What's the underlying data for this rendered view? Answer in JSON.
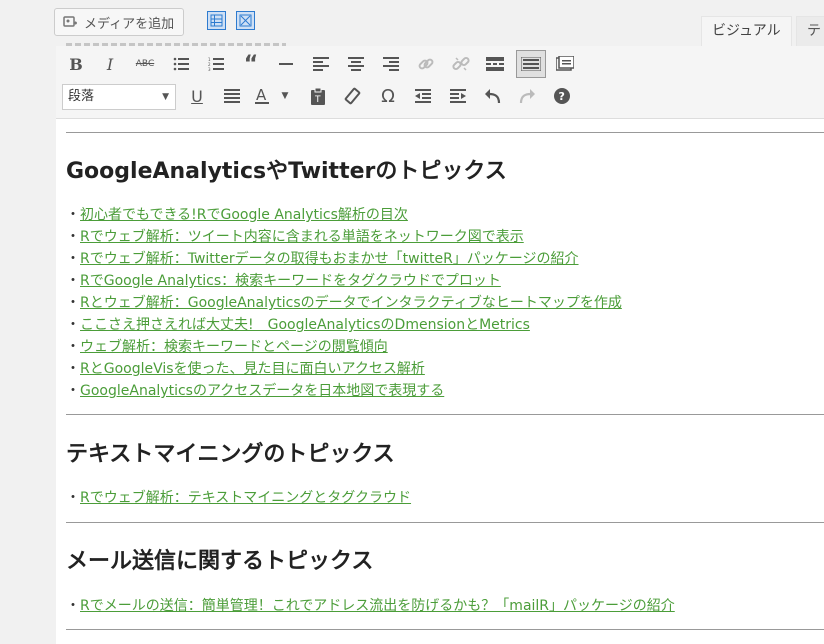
{
  "topbar": {
    "media_button_label": "メディアを追加",
    "tabs": [
      "ビジュアル",
      "テ"
    ]
  },
  "toolbar": {
    "format_select_value": "段落"
  },
  "sections": [
    {
      "heading": "GoogleAnalyticsやTwitterのトピックス",
      "items": [
        "初心者でもできる!RでGoogle Analytics解析の目次",
        "Rでウェブ解析：ツイート内容に含まれる単語をネットワーク図で表示",
        "Rでウェブ解析：Twitterデータの取得もおまかせ「twitteR」パッケージの紹介",
        "RでGoogle Analytics：検索キーワードをタグクラウドでプロット",
        "Rとウェブ解析：GoogleAnalyticsのデータでインタラクティブなヒートマップを作成",
        "ここさえ押さえれば大丈夫!　GoogleAnalyticsのDmensionとMetrics",
        "ウェブ解析：検索キーワードとページの閲覧傾向",
        "RとGoogleVisを使った、見た目に面白いアクセス解析",
        "GoogleAnalyticsのアクセスデータを日本地図で表現する"
      ]
    },
    {
      "heading": "テキストマイニングのトピックス",
      "items": [
        "Rでウェブ解析：テキストマイニングとタグクラウド"
      ]
    },
    {
      "heading": "メール送信に関するトピックス",
      "items": [
        "Rでメールの送信：簡単管理！これでアドレス流出を防げるかも？「mailR」パッケージの紹介"
      ]
    }
  ],
  "bullet": "・",
  "colors": {
    "link": "#4b9d39",
    "heading": "#222222"
  }
}
